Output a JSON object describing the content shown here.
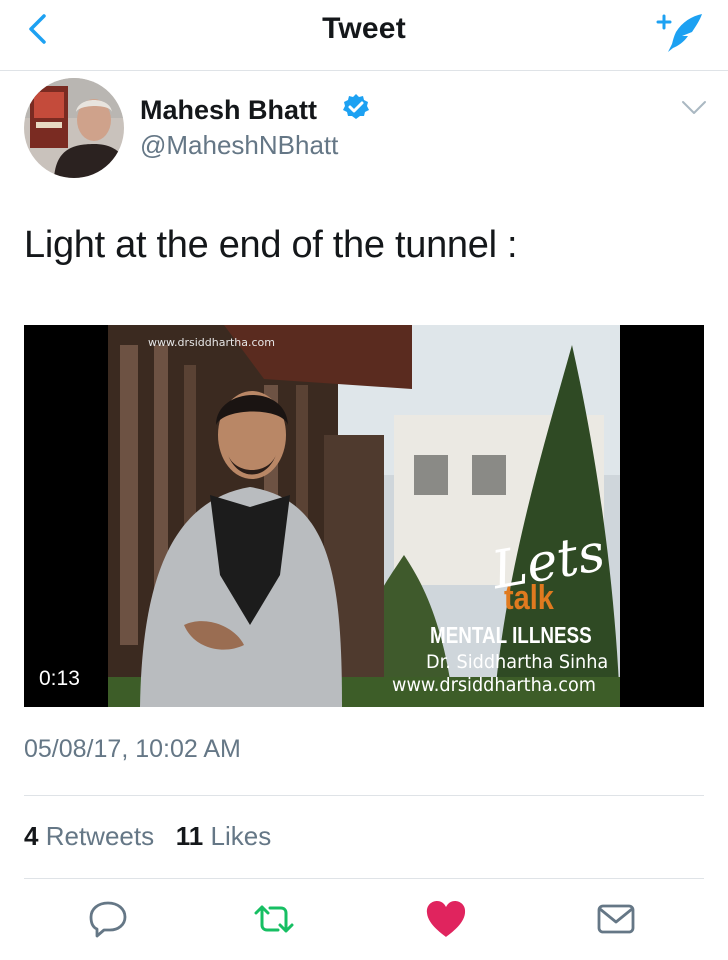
{
  "header": {
    "title": "Tweet"
  },
  "author": {
    "name": "Mahesh Bhatt",
    "handle": "@MaheshNBhatt"
  },
  "tweet": {
    "text": "Light at the end of the tunnel :",
    "timestamp": "05/08/17, 10:02 AM"
  },
  "media": {
    "top_url": "www.drsiddhartha.com",
    "lets": "Lets",
    "talk": "talk",
    "mental": "MENTAL ILLNESS",
    "doctor": "Dr. Siddhartha Sinha",
    "site": "www.drsiddhartha.com",
    "duration": "0:13"
  },
  "stats": {
    "retweets_count": "4",
    "retweets_label": "Retweets",
    "likes_count": "11",
    "likes_label": "Likes"
  },
  "icons": {
    "back": "chevron-left-icon",
    "compose": "compose-quill-icon",
    "verified": "verified-badge-icon",
    "caret": "chevron-down-icon",
    "reply": "reply-icon",
    "retweet": "retweet-icon",
    "like": "heart-icon",
    "message": "envelope-icon"
  },
  "colors": {
    "accent": "#1da1f2",
    "retweet": "#17bf63",
    "like": "#e0245e",
    "secondary_text": "#657786"
  }
}
